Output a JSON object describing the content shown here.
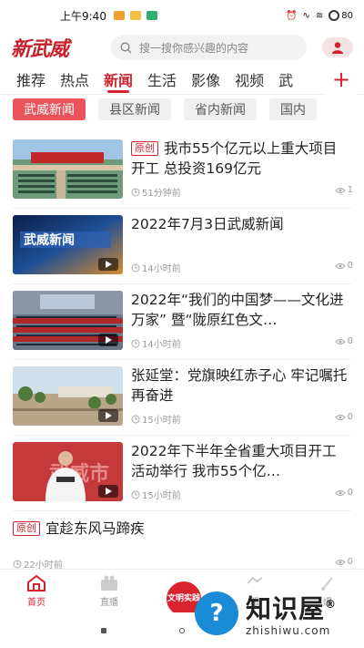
{
  "status_bar": {
    "time": "上午9:40",
    "battery": "80",
    "notif_colors": [
      "#f0a030",
      "#f0c040",
      "#30b070"
    ]
  },
  "header": {
    "logo": "新武威",
    "search_placeholder": "搜一搜你感兴趣的内容"
  },
  "tabs": [
    {
      "label": "推荐",
      "active": false
    },
    {
      "label": "热点",
      "active": false
    },
    {
      "label": "新闻",
      "active": true
    },
    {
      "label": "生活",
      "active": false
    },
    {
      "label": "影像",
      "active": false
    },
    {
      "label": "视频",
      "active": false
    },
    {
      "label": "武",
      "active": false
    }
  ],
  "add_tab": "+",
  "subtabs": [
    {
      "label": "武威新闻",
      "active": true
    },
    {
      "label": "县区新闻",
      "active": false
    },
    {
      "label": "省内新闻",
      "active": false
    },
    {
      "label": "国内",
      "active": false
    }
  ],
  "news": [
    {
      "badge": "原创",
      "title": "我市55个亿元以上重大项目开工 总投资169亿元",
      "time": "51分钟前",
      "views": "1",
      "thumb": "ceremony",
      "video": false
    },
    {
      "badge": "",
      "title": "2022年7月3日武威新闻",
      "time": "14小时前",
      "views": "0",
      "thumb": "studio",
      "video": true
    },
    {
      "badge": "",
      "title": "2022年“我们的中国梦——文化进万家” 暨“陇原红色文…",
      "time": "14小时前",
      "views": "0",
      "thumb": "auditorium",
      "video": true
    },
    {
      "badge": "",
      "title": "张延堂：党旗映红赤子心 牢记嘱托再奋进",
      "time": "15小时前",
      "views": "0",
      "thumb": "field",
      "video": true
    },
    {
      "badge": "",
      "title": "2022年下半年全省重大项目开工活动举行 我市55个亿…",
      "time": "15小时前",
      "views": "0",
      "thumb": "speaker",
      "video": true
    },
    {
      "badge": "原创",
      "title": "宜趁东风马蹄疾",
      "time": "22小时前",
      "views": "0",
      "thumb": "",
      "video": false
    }
  ],
  "bottom_nav": [
    {
      "label": "首页",
      "icon": "home-icon",
      "active": true
    },
    {
      "label": "直播",
      "icon": "live-icon",
      "active": false
    },
    {
      "label": "",
      "icon": "center-icon",
      "active": false
    },
    {
      "label": "服",
      "icon": "service-icon",
      "active": false
    },
    {
      "label": "爆",
      "icon": "report-icon",
      "active": false
    }
  ],
  "center_button": "文明实践",
  "watermark": {
    "big": "知识屋",
    "small": "zhishiwu.com",
    "reg": "®"
  }
}
